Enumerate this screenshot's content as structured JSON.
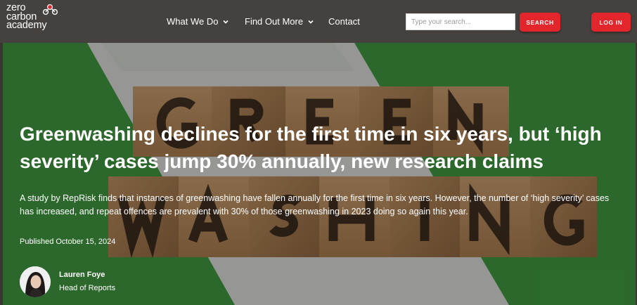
{
  "brand": {
    "logo_lines": [
      "zero",
      "carbon",
      "academy"
    ],
    "accent_color": "#e3262b"
  },
  "nav": {
    "items": [
      {
        "label": "What We Do",
        "has_dropdown": true
      },
      {
        "label": "Find Out More",
        "has_dropdown": true
      },
      {
        "label": "Contact",
        "has_dropdown": false
      }
    ]
  },
  "search": {
    "placeholder": "Type your search...",
    "value": "",
    "button_label": "SEARCH"
  },
  "login": {
    "label": "LOG IN"
  },
  "article": {
    "headline": "Greenwashing declines for the first time in six years, but ‘high severity’ cases jump 30% annually, new research claims",
    "lede": "A study by RepRisk finds that instances of greenwashing have fallen annually for the first time in six years. However, the number of ‘high severity’ cases has increased, and repeat offences are prevalent with 30% of those greenwashing in 2023 doing so again this year.",
    "published": "Published October 15, 2024",
    "author": {
      "name": "Lauren Foye",
      "role": "Head of Reports"
    }
  }
}
